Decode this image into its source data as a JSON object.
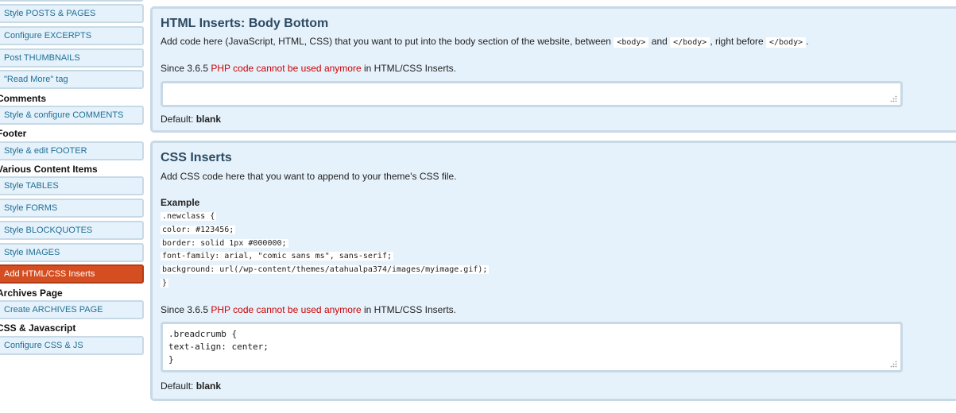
{
  "sidebar": {
    "items": [
      {
        "type": "button",
        "label": "Style POSTS & PAGES",
        "name": "sidebar-item-style-posts-pages"
      },
      {
        "type": "button",
        "label": "Configure EXCERPTS",
        "name": "sidebar-item-configure-excerpts"
      },
      {
        "type": "button",
        "label": "Post THUMBNAILS",
        "name": "sidebar-item-post-thumbnails"
      },
      {
        "type": "button",
        "label": "\"Read More\" tag",
        "name": "sidebar-item-read-more-tag"
      },
      {
        "type": "heading",
        "label": "Comments",
        "name": "sidebar-heading-comments"
      },
      {
        "type": "button",
        "label": "Style & configure COMMENTS",
        "name": "sidebar-item-style-comments"
      },
      {
        "type": "heading",
        "label": "Footer",
        "name": "sidebar-heading-footer"
      },
      {
        "type": "button",
        "label": "Style & edit FOOTER",
        "name": "sidebar-item-style-footer"
      },
      {
        "type": "heading",
        "label": "Various Content Items",
        "name": "sidebar-heading-various-content"
      },
      {
        "type": "button",
        "label": "Style TABLES",
        "name": "sidebar-item-style-tables"
      },
      {
        "type": "button",
        "label": "Style FORMS",
        "name": "sidebar-item-style-forms"
      },
      {
        "type": "button",
        "label": "Style BLOCKQUOTES",
        "name": "sidebar-item-style-blockquotes"
      },
      {
        "type": "button",
        "label": "Style IMAGES",
        "name": "sidebar-item-style-images"
      },
      {
        "type": "button",
        "label": "Add HTML/CSS Inserts",
        "name": "sidebar-item-add-html-css-inserts",
        "active": true
      },
      {
        "type": "heading",
        "label": "Archives Page",
        "name": "sidebar-heading-archives-page"
      },
      {
        "type": "button",
        "label": "Create ARCHIVES PAGE",
        "name": "sidebar-item-create-archives"
      },
      {
        "type": "heading",
        "label": "CSS & Javascript",
        "name": "sidebar-heading-css-js"
      },
      {
        "type": "button",
        "label": "Configure CSS & JS",
        "name": "sidebar-item-configure-css-js"
      }
    ]
  },
  "body_bottom": {
    "title": "HTML Inserts: Body Bottom",
    "desc_before": "Add code here (JavaScript, HTML, CSS) that you want to put into the body section of the website, between",
    "tag_body_open": "<body>",
    "and": "and",
    "tag_body_close": "</body>",
    "right_before": ", right before",
    "tag_body_close2": "</body>",
    "period": ".",
    "since": "Since 3.6.5",
    "php_warning": "PHP code cannot be used anymore",
    "in_inserts": "in HTML/CSS Inserts.",
    "textarea_value": "",
    "default_label": "Default:",
    "default_value": "blank"
  },
  "css_inserts": {
    "title": "CSS Inserts",
    "desc": "Add CSS code here that you want to append to your theme's CSS file.",
    "example_label": "Example",
    "example_lines": [
      ".newclass {",
      "color: #123456;",
      "border: solid 1px #000000;",
      "font-family: arial, \"comic sans ms\", sans-serif;",
      "background: url(/wp-content/themes/atahualpa374/images/myimage.gif);",
      "}"
    ],
    "since": "Since 3.6.5",
    "php_warning": "PHP code cannot be used anymore",
    "in_inserts": "in HTML/CSS Inserts.",
    "textarea_value": ".breadcrumb {\ntext-align: center;\n}",
    "default_label": "Default:",
    "default_value": "blank"
  },
  "colors": {
    "accent_active": "#d54e21",
    "panel_bg": "#e6f2fb",
    "panel_border": "#c8d9e6",
    "link_blue": "#1f6f95",
    "warning_red": "#cc0000"
  }
}
